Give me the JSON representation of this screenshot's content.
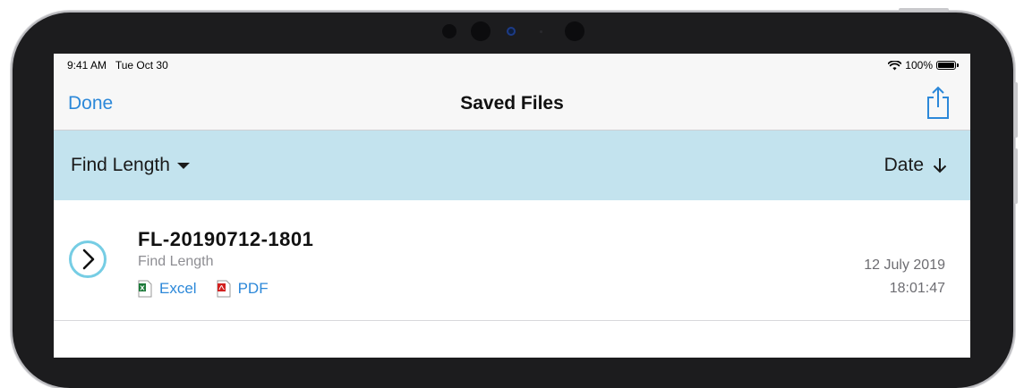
{
  "status_bar": {
    "time": "9:41 AM",
    "date": "Tue Oct 30",
    "battery": "100%"
  },
  "nav": {
    "done_label": "Done",
    "title": "Saved Files",
    "share_icon": "share-icon"
  },
  "filter": {
    "type_label": "Find Length",
    "sort_label": "Date",
    "sort_direction": "descending"
  },
  "files": [
    {
      "name": "FL-20190712-1801",
      "type": "Find Length",
      "attachments": [
        {
          "label": "Excel",
          "icon": "excel-file-icon"
        },
        {
          "label": "PDF",
          "icon": "pdf-file-icon"
        }
      ],
      "date": "12 July 2019",
      "time": "18:01:47"
    }
  ],
  "colors": {
    "accent": "#2c88d9",
    "filter_bar": "#c3e3ee",
    "chevron_ring": "#76cde4",
    "excel": "#1d7a3a",
    "pdf": "#d2201f"
  }
}
